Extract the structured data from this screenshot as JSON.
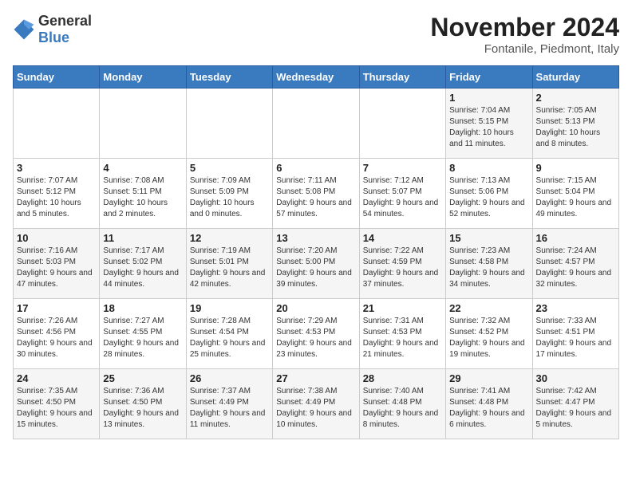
{
  "logo": {
    "general": "General",
    "blue": "Blue"
  },
  "header": {
    "month": "November 2024",
    "location": "Fontanile, Piedmont, Italy"
  },
  "days_of_week": [
    "Sunday",
    "Monday",
    "Tuesday",
    "Wednesday",
    "Thursday",
    "Friday",
    "Saturday"
  ],
  "weeks": [
    [
      {
        "day": "",
        "info": ""
      },
      {
        "day": "",
        "info": ""
      },
      {
        "day": "",
        "info": ""
      },
      {
        "day": "",
        "info": ""
      },
      {
        "day": "",
        "info": ""
      },
      {
        "day": "1",
        "info": "Sunrise: 7:04 AM\nSunset: 5:15 PM\nDaylight: 10 hours and 11 minutes."
      },
      {
        "day": "2",
        "info": "Sunrise: 7:05 AM\nSunset: 5:13 PM\nDaylight: 10 hours and 8 minutes."
      }
    ],
    [
      {
        "day": "3",
        "info": "Sunrise: 7:07 AM\nSunset: 5:12 PM\nDaylight: 10 hours and 5 minutes."
      },
      {
        "day": "4",
        "info": "Sunrise: 7:08 AM\nSunset: 5:11 PM\nDaylight: 10 hours and 2 minutes."
      },
      {
        "day": "5",
        "info": "Sunrise: 7:09 AM\nSunset: 5:09 PM\nDaylight: 10 hours and 0 minutes."
      },
      {
        "day": "6",
        "info": "Sunrise: 7:11 AM\nSunset: 5:08 PM\nDaylight: 9 hours and 57 minutes."
      },
      {
        "day": "7",
        "info": "Sunrise: 7:12 AM\nSunset: 5:07 PM\nDaylight: 9 hours and 54 minutes."
      },
      {
        "day": "8",
        "info": "Sunrise: 7:13 AM\nSunset: 5:06 PM\nDaylight: 9 hours and 52 minutes."
      },
      {
        "day": "9",
        "info": "Sunrise: 7:15 AM\nSunset: 5:04 PM\nDaylight: 9 hours and 49 minutes."
      }
    ],
    [
      {
        "day": "10",
        "info": "Sunrise: 7:16 AM\nSunset: 5:03 PM\nDaylight: 9 hours and 47 minutes."
      },
      {
        "day": "11",
        "info": "Sunrise: 7:17 AM\nSunset: 5:02 PM\nDaylight: 9 hours and 44 minutes."
      },
      {
        "day": "12",
        "info": "Sunrise: 7:19 AM\nSunset: 5:01 PM\nDaylight: 9 hours and 42 minutes."
      },
      {
        "day": "13",
        "info": "Sunrise: 7:20 AM\nSunset: 5:00 PM\nDaylight: 9 hours and 39 minutes."
      },
      {
        "day": "14",
        "info": "Sunrise: 7:22 AM\nSunset: 4:59 PM\nDaylight: 9 hours and 37 minutes."
      },
      {
        "day": "15",
        "info": "Sunrise: 7:23 AM\nSunset: 4:58 PM\nDaylight: 9 hours and 34 minutes."
      },
      {
        "day": "16",
        "info": "Sunrise: 7:24 AM\nSunset: 4:57 PM\nDaylight: 9 hours and 32 minutes."
      }
    ],
    [
      {
        "day": "17",
        "info": "Sunrise: 7:26 AM\nSunset: 4:56 PM\nDaylight: 9 hours and 30 minutes."
      },
      {
        "day": "18",
        "info": "Sunrise: 7:27 AM\nSunset: 4:55 PM\nDaylight: 9 hours and 28 minutes."
      },
      {
        "day": "19",
        "info": "Sunrise: 7:28 AM\nSunset: 4:54 PM\nDaylight: 9 hours and 25 minutes."
      },
      {
        "day": "20",
        "info": "Sunrise: 7:29 AM\nSunset: 4:53 PM\nDaylight: 9 hours and 23 minutes."
      },
      {
        "day": "21",
        "info": "Sunrise: 7:31 AM\nSunset: 4:53 PM\nDaylight: 9 hours and 21 minutes."
      },
      {
        "day": "22",
        "info": "Sunrise: 7:32 AM\nSunset: 4:52 PM\nDaylight: 9 hours and 19 minutes."
      },
      {
        "day": "23",
        "info": "Sunrise: 7:33 AM\nSunset: 4:51 PM\nDaylight: 9 hours and 17 minutes."
      }
    ],
    [
      {
        "day": "24",
        "info": "Sunrise: 7:35 AM\nSunset: 4:50 PM\nDaylight: 9 hours and 15 minutes."
      },
      {
        "day": "25",
        "info": "Sunrise: 7:36 AM\nSunset: 4:50 PM\nDaylight: 9 hours and 13 minutes."
      },
      {
        "day": "26",
        "info": "Sunrise: 7:37 AM\nSunset: 4:49 PM\nDaylight: 9 hours and 11 minutes."
      },
      {
        "day": "27",
        "info": "Sunrise: 7:38 AM\nSunset: 4:49 PM\nDaylight: 9 hours and 10 minutes."
      },
      {
        "day": "28",
        "info": "Sunrise: 7:40 AM\nSunset: 4:48 PM\nDaylight: 9 hours and 8 minutes."
      },
      {
        "day": "29",
        "info": "Sunrise: 7:41 AM\nSunset: 4:48 PM\nDaylight: 9 hours and 6 minutes."
      },
      {
        "day": "30",
        "info": "Sunrise: 7:42 AM\nSunset: 4:47 PM\nDaylight: 9 hours and 5 minutes."
      }
    ]
  ]
}
